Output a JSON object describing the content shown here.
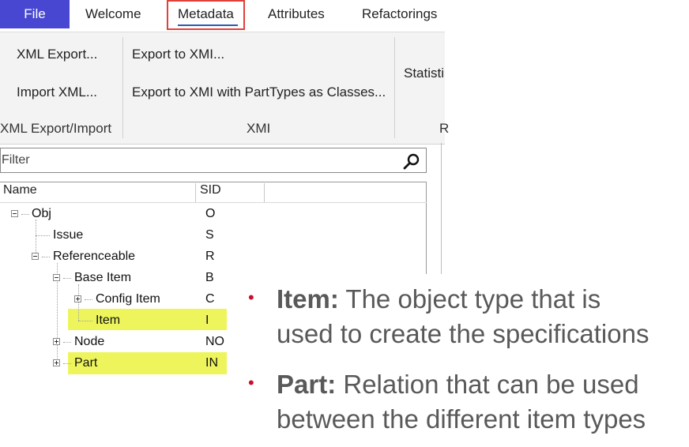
{
  "ribbon_tabs": [
    "File",
    "Welcome",
    "Metadata",
    "Attributes",
    "Refactorings"
  ],
  "ribbon": {
    "xml_export": "XML Export...",
    "import_xml": "Import XML...",
    "group_xml": "XML Export/Import",
    "export_xmi": "Export to XMI...",
    "export_xmi_parttypes": "Export to XMI with PartTypes as Classes...",
    "group_xmi": "XMI",
    "statistics": "Statisti",
    "group_r": "R"
  },
  "filter": {
    "placeholder": "Filter"
  },
  "tree": {
    "columns": [
      "Name",
      "SID"
    ],
    "rows": [
      {
        "name": "Obj",
        "sid": "O"
      },
      {
        "name": "Issue",
        "sid": "S"
      },
      {
        "name": "Referenceable",
        "sid": "R"
      },
      {
        "name": "Base Item",
        "sid": "B"
      },
      {
        "name": "Config Item",
        "sid": "C"
      },
      {
        "name": "Item",
        "sid": "I"
      },
      {
        "name": "Node",
        "sid": "NO"
      },
      {
        "name": "Part",
        "sid": "IN"
      }
    ]
  },
  "bullets": [
    {
      "term": "Item:",
      "line1": " The object type that is",
      "line2": "used to create the specifications"
    },
    {
      "term": "Part:",
      "line1": " Relation that can be used",
      "line2": "between the different item types"
    }
  ],
  "colors": {
    "file_tab": "#4747d1",
    "highlight": "#eef55c",
    "callout_box": "#e0403a",
    "bullet": "#c8102e"
  }
}
